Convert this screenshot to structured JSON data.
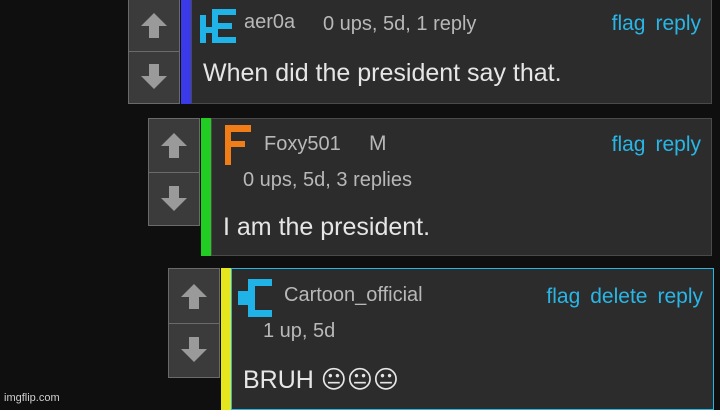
{
  "colors": {
    "background": "#0f0f0f",
    "panel": "#2c2c2c",
    "link": "#29b6e6",
    "bar_c1": "#3a3ae8",
    "bar_c2": "#22cc22",
    "bar_c3": "#e6e61e",
    "avatar_c1": "#1fb3e8",
    "avatar_c2": "#f07d17",
    "avatar_c3": "#1fb3e8"
  },
  "icons": {
    "upvote": "arrow-up-icon",
    "downvote": "arrow-down-icon"
  },
  "comments": [
    {
      "username": "aer0a",
      "meta": "0 ups, 5d, 1 reply",
      "actions": [
        "flag",
        "reply"
      ],
      "body": "When did the president say that."
    },
    {
      "username": "Foxy501",
      "badge": "M",
      "meta": "0 ups, 5d, 3 replies",
      "actions": [
        "flag",
        "reply"
      ],
      "body": "I am the president."
    },
    {
      "username": "Cartoon_official",
      "meta": "1 up, 5d",
      "actions": [
        "flag",
        "delete",
        "reply"
      ],
      "body": "BRUH 😐😐😐"
    }
  ],
  "watermark": "imgflip.com"
}
